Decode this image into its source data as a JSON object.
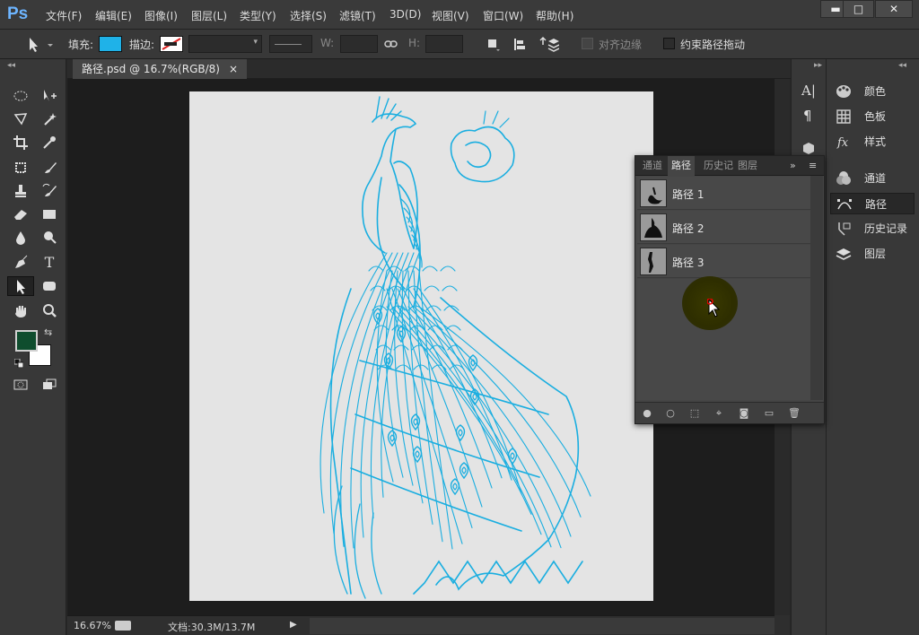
{
  "app": {
    "logo": "Ps"
  },
  "menu": [
    "文件(F)",
    "编辑(E)",
    "图像(I)",
    "图层(L)",
    "类型(Y)",
    "选择(S)",
    "滤镜(T)",
    "3D(D)",
    "视图(V)",
    "窗口(W)",
    "帮助(H)"
  ],
  "window_controls": {
    "minimize": "▬",
    "maximize": "□",
    "close": "✕"
  },
  "options": {
    "fill_label": "填充:",
    "stroke_label": "描边:",
    "w_label": "W:",
    "h_label": "H:",
    "align_edges_label": "对齐边缘",
    "constrain_label": "约束路径拖动",
    "fill_color": "#1fb2e8"
  },
  "document": {
    "tab_title": "路径.psd @ 16.7%(RGB/8)",
    "tab_close": "×",
    "zoom": "16.67%",
    "doc_info": "文档:30.3M/13.7M",
    "art_color": "#1aaee0"
  },
  "colors": {
    "foreground": "#0f4d2e",
    "background": "#ffffff"
  },
  "right_panel": {
    "items": [
      {
        "label": "颜色",
        "icon": "palette-icon"
      },
      {
        "label": "色板",
        "icon": "swatches-grid-icon"
      },
      {
        "label": "样式",
        "icon": "fx-styles-icon"
      },
      {
        "label": "通道",
        "icon": "channels-icon"
      },
      {
        "label": "路径",
        "icon": "paths-pen-icon"
      },
      {
        "label": "历史记录",
        "icon": "history-icon"
      },
      {
        "label": "图层",
        "icon": "layers-icon"
      }
    ]
  },
  "paths_panel": {
    "tabs": [
      "通道",
      "路径",
      "历史记",
      "图层"
    ],
    "paths": [
      {
        "name": "路径 1"
      },
      {
        "name": "路径 2"
      },
      {
        "name": "路径 3"
      }
    ],
    "expand": "»",
    "menu": "≡"
  }
}
